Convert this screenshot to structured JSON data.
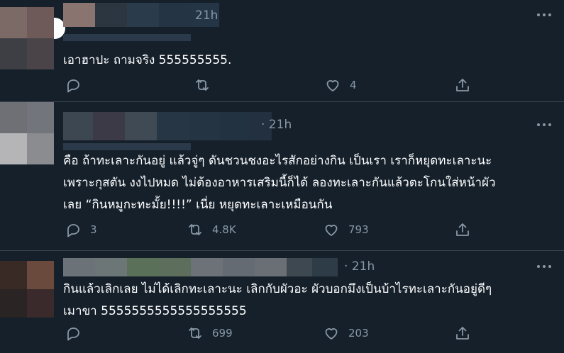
{
  "tweets": [
    {
      "timestamp": "21h",
      "text": "เอาฮาปะ ถามจริง 555555555.",
      "reply_count": "",
      "retweet_count": "",
      "like_count": "4"
    },
    {
      "timestamp": "21h",
      "text": "คือ ถ้าทะเลาะกันอยู่ แล้วจู่ๆ ดันชวนชงอะไรสักอย่างกิน เป็นเรา เราก็หยุดทะเลาะนะ\nเพราะกุสตัน งงไปหมด ไม่ต้องอาหารเสริมนี้ก็ได้ ลองทะเลาะกันแล้วตะโกนใส่หน้าผัว\nเลย “กินหมูกะทะมั้ย!!!!” เนี่ย หยุดทะเลาะเหมือนกัน",
      "reply_count": "3",
      "retweet_count": "4.8K",
      "like_count": "793"
    },
    {
      "timestamp": "21h",
      "text": "กินแล้วเลิกเลย ไม่ได้เลิกทะเลาะนะ เลิกกับผัวอะ ผัวบอกมึงเป็นบ้าไรทะเลาะกันอยู่ดีๆ\nเมาขา 5555555555555555555",
      "reply_count": "",
      "retweet_count": "699",
      "like_count": "203"
    }
  ],
  "icons": {
    "reply": "reply-icon",
    "retweet": "retweet-icon",
    "like": "heart-icon",
    "share": "share-icon",
    "more": "more-icon"
  },
  "colors": {
    "background": "#15202b",
    "divider": "#38444d",
    "secondary_text": "#8899a6",
    "primary_text": "#ffffff"
  }
}
